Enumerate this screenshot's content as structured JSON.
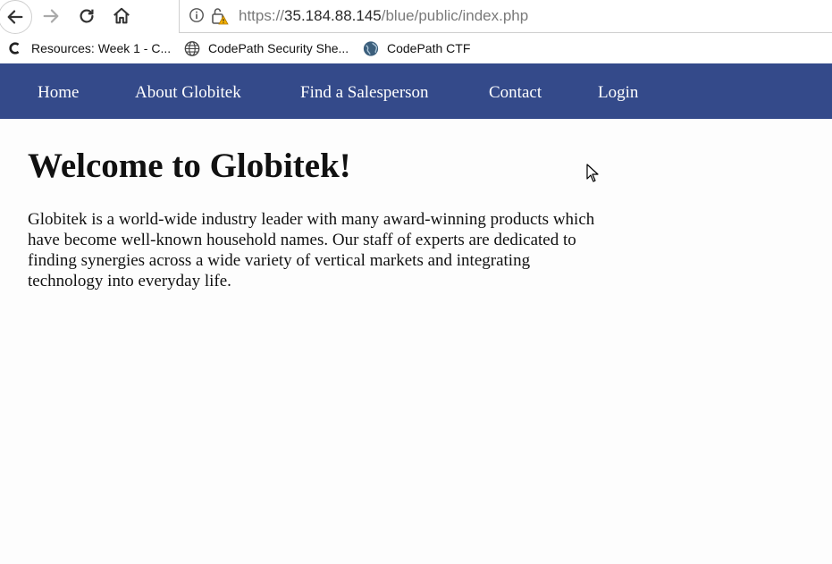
{
  "browser": {
    "url_scheme": "https://",
    "url_host": "35.184.88.145",
    "url_path": "/blue/public/index.php",
    "bookmarks": [
      {
        "label": "Resources: Week 1 - C...",
        "icon": "codepath-c-icon"
      },
      {
        "label": "CodePath Security She...",
        "icon": "globe-icon"
      },
      {
        "label": "CodePath CTF",
        "icon": "earth-icon"
      }
    ]
  },
  "nav": {
    "items": [
      "Home",
      "About Globitek",
      "Find a Salesperson",
      "Contact",
      "Login"
    ],
    "background": "#344a8a"
  },
  "main": {
    "title": "Welcome to Globitek!",
    "paragraph": "Globitek is a world-wide industry leader with many award-winning products which have become well-known household names. Our staff of experts are dedicated to finding synergies across a wide variety of vertical markets and integrating technology into everyday life."
  }
}
